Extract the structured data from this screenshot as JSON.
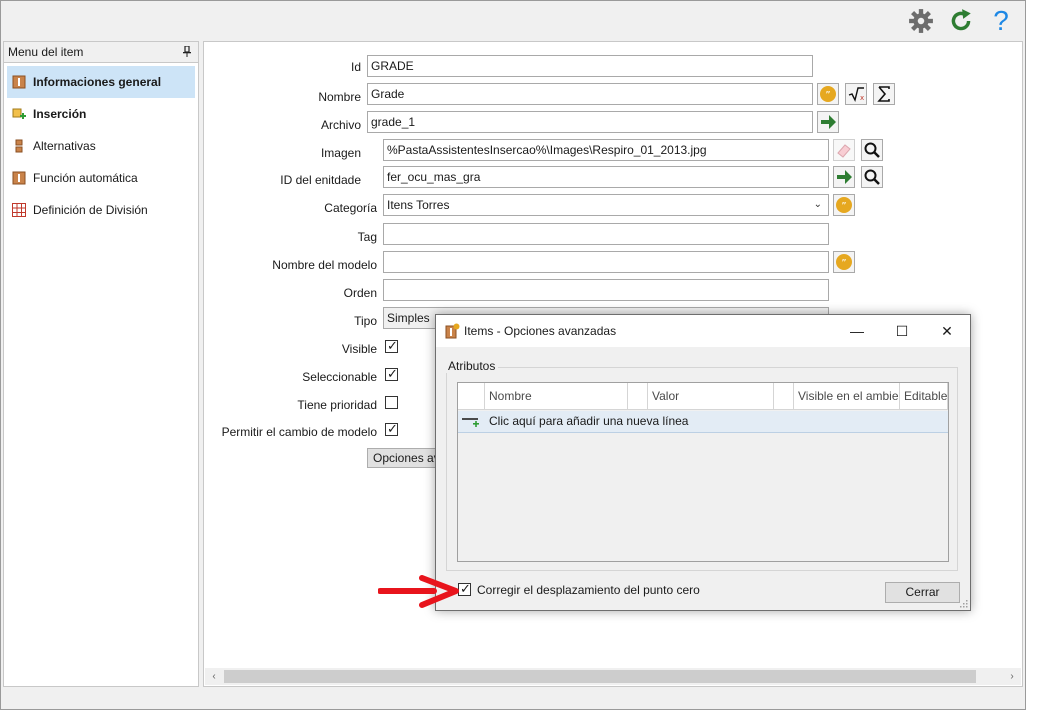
{
  "toolbar": {
    "icons": [
      "gear-icon",
      "refresh-icon",
      "help-icon"
    ],
    "help_glyph": "?"
  },
  "sidebar": {
    "title": "Menu del item",
    "items": [
      {
        "label": "Informaciones general",
        "icon": "item-info-icon",
        "active": true
      },
      {
        "label": "Inserción",
        "icon": "insertion-icon",
        "active": false
      },
      {
        "label": "Alternativas",
        "icon": "alternatives-icon",
        "active": false
      },
      {
        "label": "Función automática",
        "icon": "auto-function-icon",
        "active": false
      },
      {
        "label": "Definición de División",
        "icon": "grid-division-icon",
        "active": false
      }
    ]
  },
  "form": {
    "id": {
      "label": "Id",
      "value": "GRADE"
    },
    "nombre": {
      "label": "Nombre",
      "value": "Grade"
    },
    "archivo": {
      "label": "Archivo",
      "value": "grade_1"
    },
    "imagen": {
      "label": "Imagen",
      "value": "%PastaAssistentesInsercao%\\Images\\Respiro_01_2013.jpg"
    },
    "id_entidad": {
      "label": "ID del enitdade",
      "value": "fer_ocu_mas_gra"
    },
    "categoria": {
      "label": "Categoría",
      "value": "Itens Torres"
    },
    "tag": {
      "label": "Tag",
      "value": ""
    },
    "nombre_modelo": {
      "label": "Nombre del modelo",
      "value": ""
    },
    "orden": {
      "label": "Orden",
      "value": ""
    },
    "tipo": {
      "label": "Tipo",
      "value": "Simples"
    },
    "visible": {
      "label": "Visible",
      "checked": true
    },
    "seleccionable": {
      "label": "Seleccionable",
      "checked": true
    },
    "tiene_prioridad": {
      "label": "Tiene prioridad",
      "checked": false
    },
    "permitir_cambio": {
      "label": "Permitir el cambio de modelo",
      "checked": true
    },
    "opciones_button": "Opciones av",
    "check_glyph": "✓"
  },
  "dialog": {
    "title": "Items - Opciones avanzadas",
    "window_buttons": {
      "minimize": "—",
      "maximize": "☐",
      "close": "✕"
    },
    "group_label": "Atributos",
    "columns": [
      "Nombre",
      "Valor",
      "Visible en el ambiente",
      "Editable"
    ],
    "new_row_text": "Clic aquí para añadir una nueva línea",
    "footer_checkbox": {
      "label": "Corregir el desplazamiento del punto cero",
      "checked": true
    },
    "close_button": "Cerrar"
  },
  "colors": {
    "accent_selected": "#cde4f7",
    "arrow_red": "#e8141c",
    "green_icon": "#2e7d32",
    "help_blue": "#1e88e5",
    "gear_gray": "#6d6d6d"
  }
}
